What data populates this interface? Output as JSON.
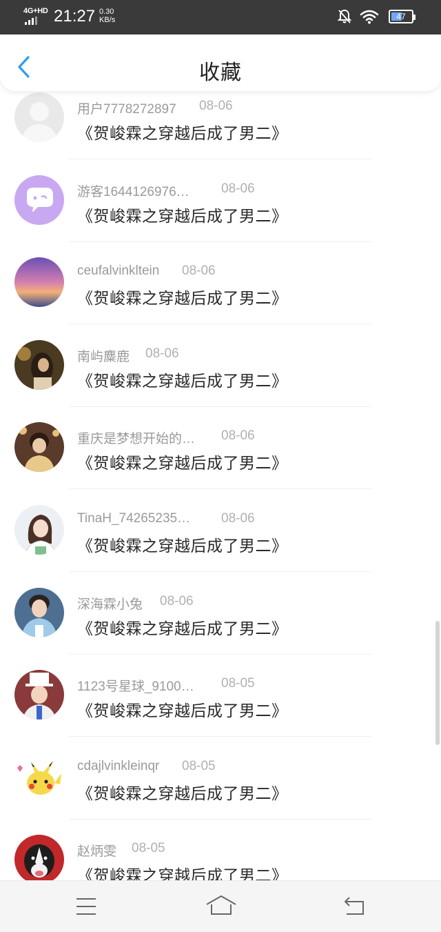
{
  "status_bar": {
    "network": "4G+HD",
    "time": "21:27",
    "speed_value": "0.30",
    "speed_unit": "KB/s",
    "battery": "47",
    "icons": [
      "bell-off-icon",
      "wifi-icon",
      "battery-icon"
    ]
  },
  "header": {
    "title": "收藏",
    "back_icon": "chevron-left-icon",
    "accent_color": "#2e9bf0"
  },
  "favorites": [
    {
      "user": "用户7778272897",
      "date": "08-06",
      "title": "《贺峻霖之穿越后成了男二》",
      "avatar": "default-avatar"
    },
    {
      "user": "游客1644126976…",
      "date": "08-06",
      "title": "《贺峻霖之穿越后成了男二》",
      "avatar": "purple-chat-avatar"
    },
    {
      "user": "ceufalvinkltein",
      "date": "08-06",
      "title": "《贺峻霖之穿越后成了男二》",
      "avatar": "sunset-avatar"
    },
    {
      "user": "南屿麋鹿",
      "date": "08-06",
      "title": "《贺峻霖之穿越后成了男二》",
      "avatar": "photo-avatar"
    },
    {
      "user": "重庆是梦想开始的…",
      "date": "08-06",
      "title": "《贺峻霖之穿越后成了男二》",
      "avatar": "photo-avatar"
    },
    {
      "user": "TinaH_74265235…",
      "date": "08-06",
      "title": "《贺峻霖之穿越后成了男二》",
      "avatar": "illustration-avatar"
    },
    {
      "user": "深海霖小兔",
      "date": "08-06",
      "title": "《贺峻霖之穿越后成了男二》",
      "avatar": "photo-avatar"
    },
    {
      "user": "1123号星球_9100…",
      "date": "08-05",
      "title": "《贺峻霖之穿越后成了男二》",
      "avatar": "photo-avatar"
    },
    {
      "user": "cdajlvinkleinqr",
      "date": "08-05",
      "title": "《贺峻霖之穿越后成了男二》",
      "avatar": "pikachu-avatar"
    },
    {
      "user": "赵炳雯",
      "date": "08-05",
      "title": "《贺峻霖之穿越后成了男二》",
      "avatar": "dog-avatar"
    }
  ],
  "nav_bar": {
    "icons": [
      "menu-icon",
      "home-icon",
      "back-icon"
    ]
  }
}
